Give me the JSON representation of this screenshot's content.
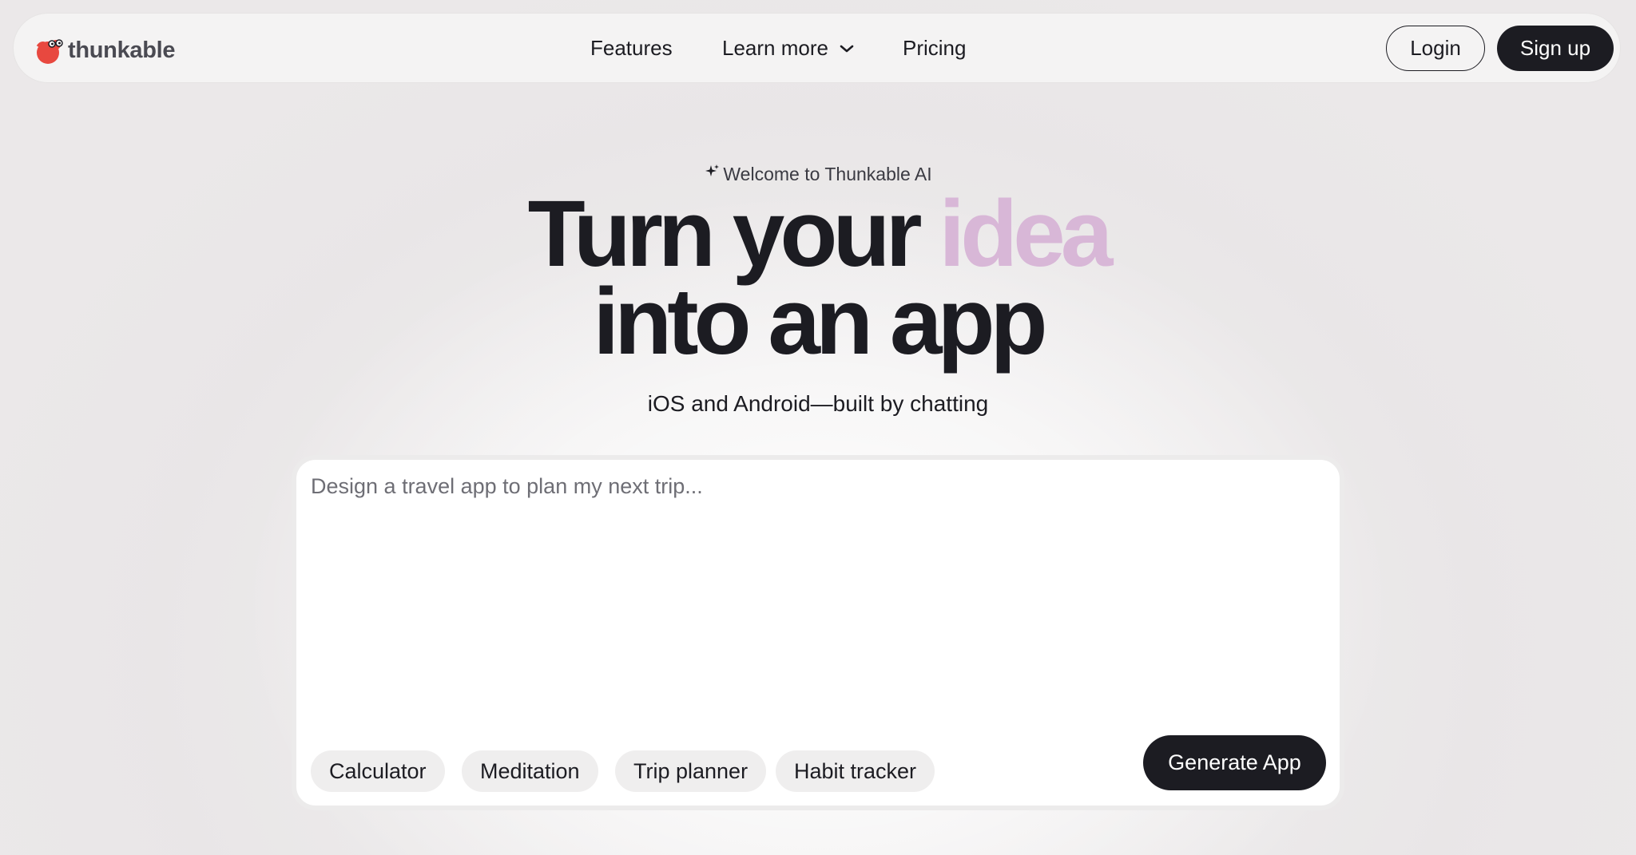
{
  "brand": {
    "name": "thunkable",
    "logo_color": "#e8483f"
  },
  "nav": {
    "links": [
      {
        "label": "Features"
      },
      {
        "label": "Learn more",
        "has_dropdown": true
      },
      {
        "label": "Pricing"
      }
    ],
    "login_label": "Login",
    "signup_label": "Sign up"
  },
  "hero": {
    "eyebrow": "Welcome to Thunkable AI",
    "eyebrow_icon": "sparkle-icon",
    "headline_part1": "Turn your",
    "headline_accent": "idea",
    "headline_line2": "into an app",
    "accent_color": "#d8b7d7",
    "subhead": "iOS and Android—built by chatting"
  },
  "prompt": {
    "placeholder": "Design a travel app to plan my next trip...",
    "value": "",
    "suggestions": [
      "Calculator",
      "Meditation",
      "Trip planner",
      "Habit tracker"
    ],
    "submit_label": "Generate App"
  }
}
